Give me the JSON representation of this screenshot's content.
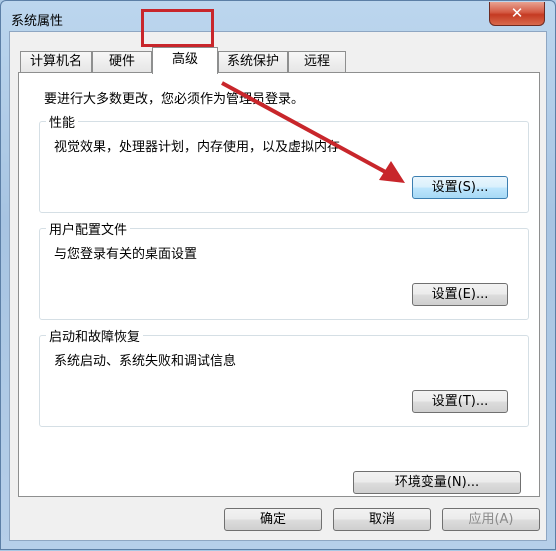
{
  "window": {
    "title": "系统属性",
    "close_glyph": "✕"
  },
  "tabs": [
    {
      "label": "计算机名"
    },
    {
      "label": "硬件"
    },
    {
      "label": "高级"
    },
    {
      "label": "系统保护"
    },
    {
      "label": "远程"
    }
  ],
  "advanced": {
    "admin_note": "要进行大多数更改，您必须作为管理员登录。",
    "performance": {
      "title": "性能",
      "description": "视觉效果，处理器计划，内存使用，以及虚拟内存",
      "button": "设置(S)..."
    },
    "user_profiles": {
      "title": "用户配置文件",
      "description": "与您登录有关的桌面设置",
      "button": "设置(E)..."
    },
    "startup_recovery": {
      "title": "启动和故障恢复",
      "description": "系统启动、系统失败和调试信息",
      "button": "设置(T)..."
    },
    "env_button": "环境变量(N)..."
  },
  "footer": {
    "ok": "确定",
    "cancel": "取消",
    "apply": "应用(A)"
  },
  "annotation": {
    "highlight_color": "#c8262b"
  }
}
